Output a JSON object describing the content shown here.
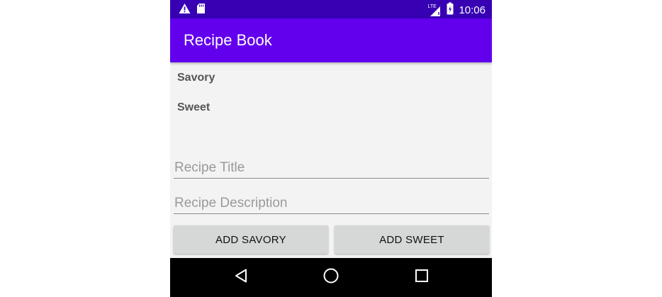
{
  "status_bar": {
    "time": "10:06",
    "network_label": "LTE",
    "left_icons": [
      "warning-icon",
      "sd-card-icon"
    ],
    "right_icons": [
      "signal-icon",
      "battery-icon"
    ]
  },
  "app_bar": {
    "title": "Recipe Book"
  },
  "categories": [
    {
      "label": "Savory"
    },
    {
      "label": "Sweet"
    }
  ],
  "form": {
    "title_field": {
      "placeholder": "Recipe Title",
      "value": ""
    },
    "description_field": {
      "placeholder": "Recipe Description",
      "value": ""
    }
  },
  "buttons": {
    "add_savory": "ADD SAVORY",
    "add_sweet": "ADD SWEET"
  },
  "nav_bar": {
    "icons": [
      "back-icon",
      "home-icon",
      "recents-icon"
    ]
  },
  "colors": {
    "status_bar": "#3700b3",
    "app_bar": "#6200ee",
    "button": "#d6d7d7",
    "nav_bar": "#000000"
  }
}
